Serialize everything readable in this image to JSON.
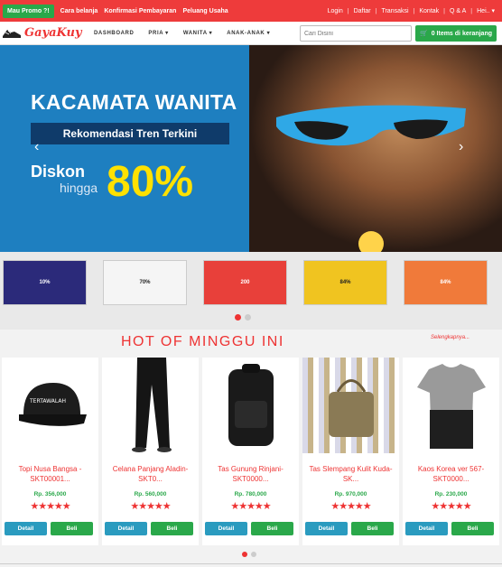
{
  "topbar": {
    "promo_label": "Mau Promo ?!",
    "links": [
      "Cara belanja",
      "Konfirmasi Pembayaran",
      "Peluang Usaha"
    ],
    "right_links": [
      "Login",
      "Daftar",
      "Transaksi",
      "Kontak",
      "Q & A",
      "Hei.."
    ]
  },
  "navbar": {
    "brand": "GayaKuy",
    "items": [
      "DASHBOARD",
      "PRIA ▾",
      "WANITA ▾",
      "ANAK-ANAK ▾"
    ],
    "search_placeholder": "Cari Disini",
    "cart_label": "0 Items di keranjang"
  },
  "hero": {
    "title": "KACAMATA WANITA",
    "subtitle": "Rekomendasi Tren Terkini",
    "discount_word": "Diskon",
    "hingga": "hingga",
    "percent": "80%"
  },
  "promo_thumbs": [
    {
      "text": "10%",
      "color": "#2b2a7a"
    },
    {
      "text": "70%",
      "color": "#f5f5f5"
    },
    {
      "text": "200",
      "color": "#e8403a"
    },
    {
      "text": "84%",
      "color": "#f0c420"
    },
    {
      "text": "84%",
      "color": "#f07a3a"
    }
  ],
  "section": {
    "title": "HOT OF MINGGU INI",
    "more": "Selengkapnya..."
  },
  "products": [
    {
      "name": "Topi Nusa Bangsa - SKT00001...",
      "price": "Rp. 356,000",
      "stars": "★★★★★"
    },
    {
      "name": "Celana Panjang Aladin-SKT0...",
      "price": "Rp. 560,000",
      "stars": "★★★★★"
    },
    {
      "name": "Tas Gunung Rinjani-SKT0000...",
      "price": "Rp. 780,000",
      "stars": "★★★★★"
    },
    {
      "name": "Tas Slempang Kulit Kuda-SK...",
      "price": "Rp. 970,000",
      "stars": "★★★★★"
    },
    {
      "name": "Kaos Korea ver 567-SKT0000...",
      "price": "Rp. 230,000",
      "stars": "★★★★★"
    }
  ],
  "buttons": {
    "detail": "Detail",
    "beli": "Beli"
  },
  "colors": {
    "primary": "#ee3b3b",
    "green": "#2aa84a",
    "blue": "#2a9bbf"
  }
}
